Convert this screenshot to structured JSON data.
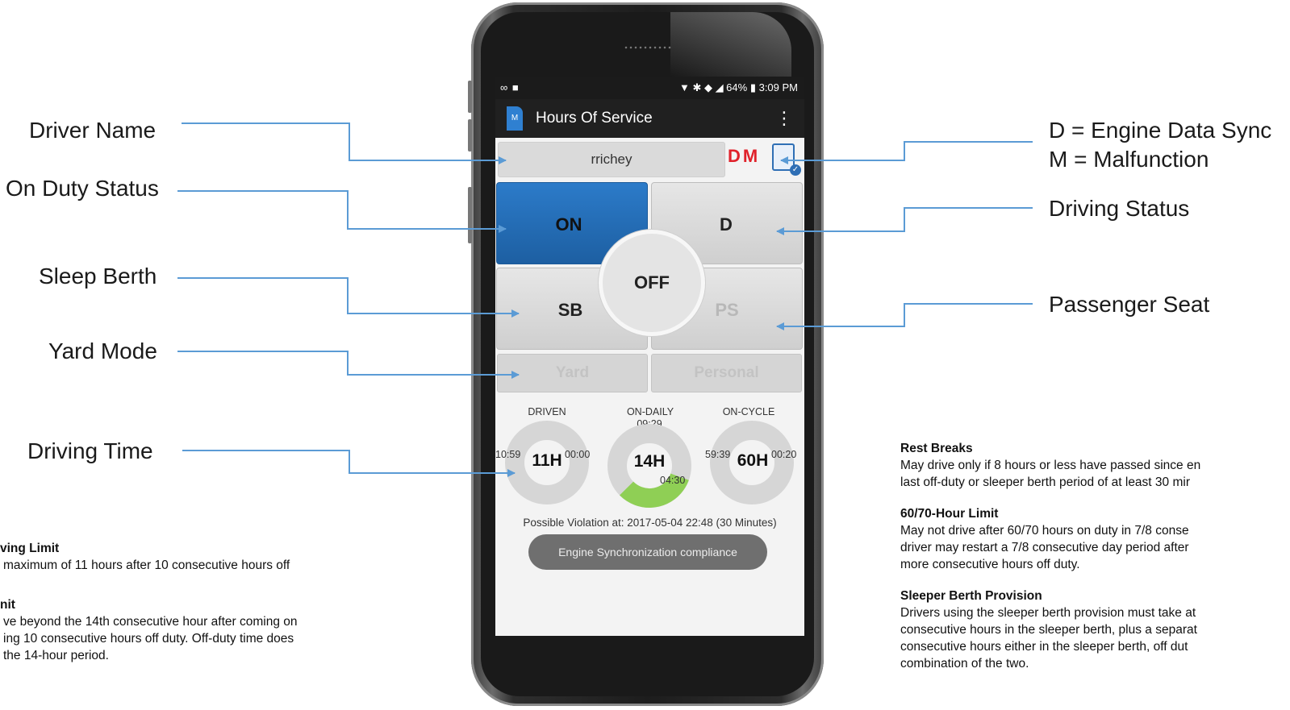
{
  "callouts": {
    "driver_name": "Driver Name",
    "on_duty_status": "On Duty Status",
    "sleep_berth": "Sleep Berth",
    "yard_mode": "Yard Mode",
    "driving_time": "Driving Time",
    "engine_sync": "D = Engine Data Sync",
    "malfunction": "M = Malfunction",
    "driving_status": "Driving Status",
    "passenger_seat": "Passenger Seat"
  },
  "left_notes": {
    "driving_limit_heading": "ving Limit",
    "driving_limit_line1": "maximum of 11 hours after 10 consecutive hours off",
    "limit_heading": "nit",
    "limit_line1": "ve beyond the 14th consecutive hour after coming on",
    "limit_line2": "ing 10 consecutive hours off duty. Off-duty time does",
    "limit_line3": "the 14-hour period."
  },
  "right_notes": {
    "rest_heading": "Rest Breaks",
    "rest_line1": "May drive only if 8 hours or less have passed since en",
    "rest_line2": "last off-duty or sleeper berth period of at least 30 mir",
    "limit_heading": "60/70-Hour Limit",
    "limit_line1": "May not drive after 60/70 hours on duty in 7/8 conse",
    "limit_line2": "driver may restart a 7/8 consecutive day period after",
    "limit_line3": "more consecutive hours off duty.",
    "sleeper_heading": "Sleeper Berth Provision",
    "sleeper_line1": "Drivers using the sleeper berth provision must take at",
    "sleeper_line2": "consecutive hours in the sleeper berth, plus a separat",
    "sleeper_line3": "consecutive hours either in the sleeper berth, off dut",
    "sleeper_line4": "combination of the two."
  },
  "statusbar": {
    "left": "∞ ■",
    "right": "▼ ✱ ◆ ◢ 64% ▮ 3:09 PM"
  },
  "app": {
    "title": "Hours Of Service",
    "logo_text": "M",
    "menu_icon": "⋮"
  },
  "driver": {
    "name": "rrichey",
    "flags": "DM"
  },
  "status_buttons": {
    "on": "ON",
    "d": "D",
    "off": "OFF",
    "sb": "SB",
    "ps": "PS",
    "yard": "Yard",
    "personal": "Personal"
  },
  "gauges": {
    "driven": {
      "label": "DRIVEN",
      "center": "11H",
      "left": "10:59",
      "right": "00:00"
    },
    "on_daily": {
      "label": "ON-DAILY",
      "center": "14H",
      "top": "09:29",
      "bottom": "04:30",
      "progress": 0.32
    },
    "on_cycle": {
      "label": "ON-CYCLE",
      "center": "60H",
      "left": "59:39",
      "right": "00:20"
    }
  },
  "violation_text": "Possible Violation at: 2017-05-04 22:48  (30 Minutes)",
  "engine_button": "Engine Synchronization compliance",
  "colors": {
    "accent_blue": "#1d5fa2",
    "flag_red": "#e0222b",
    "progress_green": "#8fcf55",
    "gauge_gray": "#d6d6d6",
    "callout_line": "#5b9bd5"
  }
}
